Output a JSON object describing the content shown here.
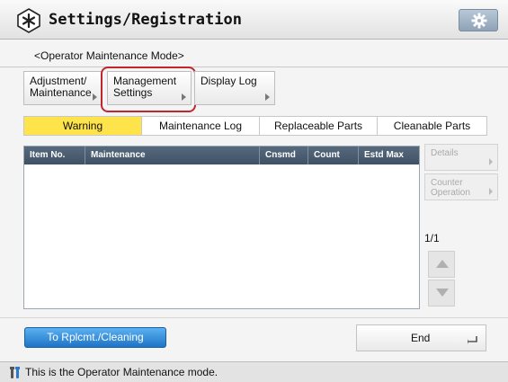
{
  "header": {
    "title": "Settings/Registration",
    "icon": "settings-registration-icon",
    "gear_icon": "gear-icon"
  },
  "subtitle": "<Operator Maintenance Mode>",
  "menu": [
    {
      "line1": "Adjustment/",
      "line2": "Maintenance"
    },
    {
      "line1": "Management",
      "line2": "Settings",
      "highlighted": true
    },
    {
      "line1": "Display Log",
      "line2": ""
    }
  ],
  "tabs": [
    {
      "label": "Warning",
      "active": true
    },
    {
      "label": "Maintenance Log"
    },
    {
      "label": "Replaceable Parts"
    },
    {
      "label": "Cleanable Parts"
    }
  ],
  "table": {
    "columns": [
      "Item No.",
      "Maintenance",
      "Cnsmd",
      "Count",
      "Estd Max"
    ],
    "rows": []
  },
  "side_buttons": {
    "details": "Details",
    "counter_line1": "Counter",
    "counter_line2": "Operation"
  },
  "page_indicator": "1/1",
  "footer": {
    "replace_button": "To Rplcmt./Cleaning",
    "end_button": "End"
  },
  "status": {
    "text": "This is the Operator Maintenance mode.",
    "icon": "wrench-icon"
  },
  "colors": {
    "active_tab": "#ffe34a",
    "highlight_ring": "#c0262e",
    "primary_button": "#1e74c6"
  }
}
